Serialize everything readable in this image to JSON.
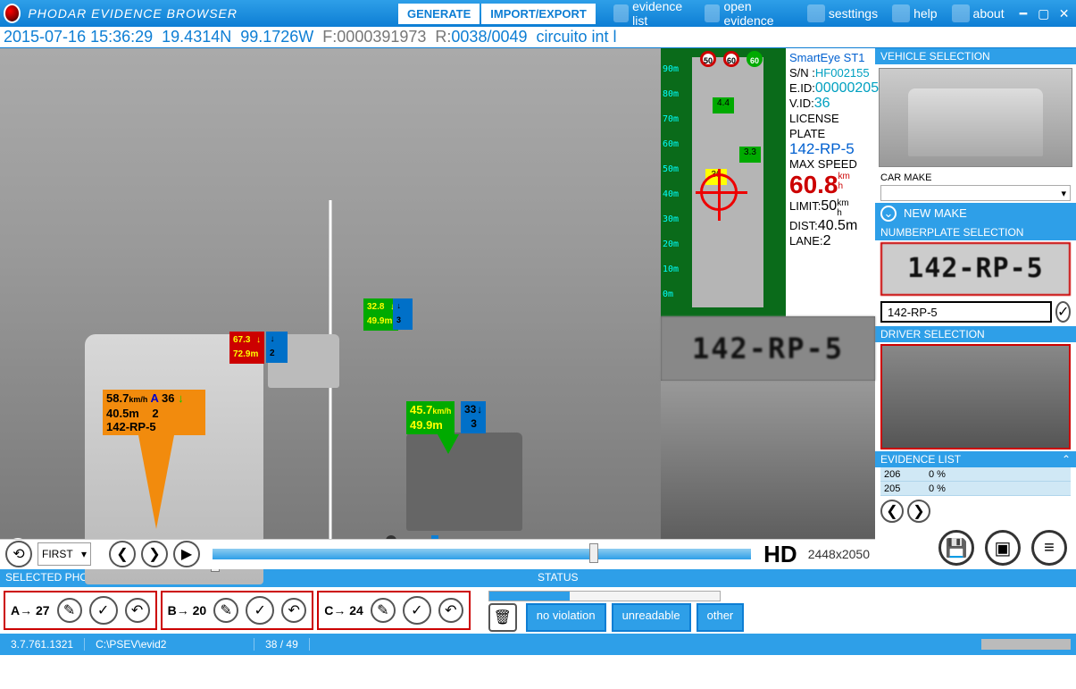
{
  "app": {
    "title": "PHODAR EVIDENCE BROWSER"
  },
  "tabs": {
    "generate": "GENERATE",
    "import_export": "IMPORT/EXPORT"
  },
  "menu": {
    "evidence_list": "evidence list",
    "open_evidence": "open evidence",
    "settings": "sesttings",
    "help": "help",
    "about": "about"
  },
  "info_strip": {
    "datetime": "2015-07-16 15:36:29",
    "lat": "19.4314N",
    "lon": "99.1726W",
    "f_label": "F:",
    "f_value": "0000391973",
    "r_label": "R:",
    "r_value": "0038/0049",
    "location": "circuito int l"
  },
  "overlays": {
    "primary": {
      "speed": "58.7",
      "unit": "km/h",
      "vid": "36",
      "dist": "40.5m",
      "lane": "2",
      "plate": "142-RP-5"
    },
    "ov2": {
      "speed": "67.3",
      "dist": "72.9m",
      "lane": "2"
    },
    "ov3": {
      "speed": "45.7",
      "unit": "km/h",
      "dist": "49.9m",
      "vid": "33",
      "lane": "3"
    },
    "ov4": {
      "speed": "32.8",
      "dist": "49.9m",
      "lane": "3"
    }
  },
  "radar": {
    "ticks": [
      "90m",
      "80m",
      "70m",
      "60m",
      "50m",
      "40m",
      "30m",
      "20m",
      "10m",
      "0m"
    ],
    "signs": [
      "50",
      "60",
      "60"
    ],
    "vlabels": {
      "a": "4.4",
      "b": "3.3",
      "t": "36"
    },
    "device": "SmartEye ST1",
    "sn_label": "S/N :",
    "sn": "HF002155",
    "eid_label": "E.ID:",
    "eid": "00000205",
    "vid_label": "V.ID:",
    "vid": "36",
    "plate_label": "LICENSE PLATE",
    "plate": "142-RP-5",
    "maxspeed_label": "MAX SPEED",
    "maxspeed": "60.8",
    "maxspeed_unit": "km/h",
    "limit_label": "LIMIT:",
    "limit": "50",
    "limit_unit": "km/h",
    "dist_label": "DIST:",
    "dist": "40.5m",
    "lane_label": "LANE:",
    "lane": "2",
    "crop_plate": "142-RP-5"
  },
  "controls": {
    "first_dd": "FIRST",
    "hd": "HD",
    "resolution": "2448x2050"
  },
  "selected_photos": {
    "header": "SELECTED PHOTOS",
    "groups": [
      {
        "letter": "A",
        "num": "27"
      },
      {
        "letter": "B",
        "num": "20"
      },
      {
        "letter": "C",
        "num": "24"
      }
    ]
  },
  "status": {
    "header": "STATUS",
    "btns": {
      "no_violation": "no violation",
      "unreadable": "unreadable",
      "other": "other"
    }
  },
  "right": {
    "vehicle_sel": "VEHICLE SELECTION",
    "car_make": "CAR MAKE",
    "new_make": "NEW MAKE",
    "numberplate_sel": "NUMBERPLATE SELECTION",
    "plate_crop": "142-RP-5",
    "plate_input": "142-RP-5",
    "driver_sel": "DRIVER SELECTION",
    "evidence_list": "EVIDENCE LIST",
    "evrows": [
      {
        "id": "206",
        "pct": "0 %"
      },
      {
        "id": "205",
        "pct": "0 %"
      }
    ]
  },
  "statusbar": {
    "version": "3.7.761.1321",
    "path": "C:\\PSEV\\evid2",
    "counter": "38 / 49"
  }
}
